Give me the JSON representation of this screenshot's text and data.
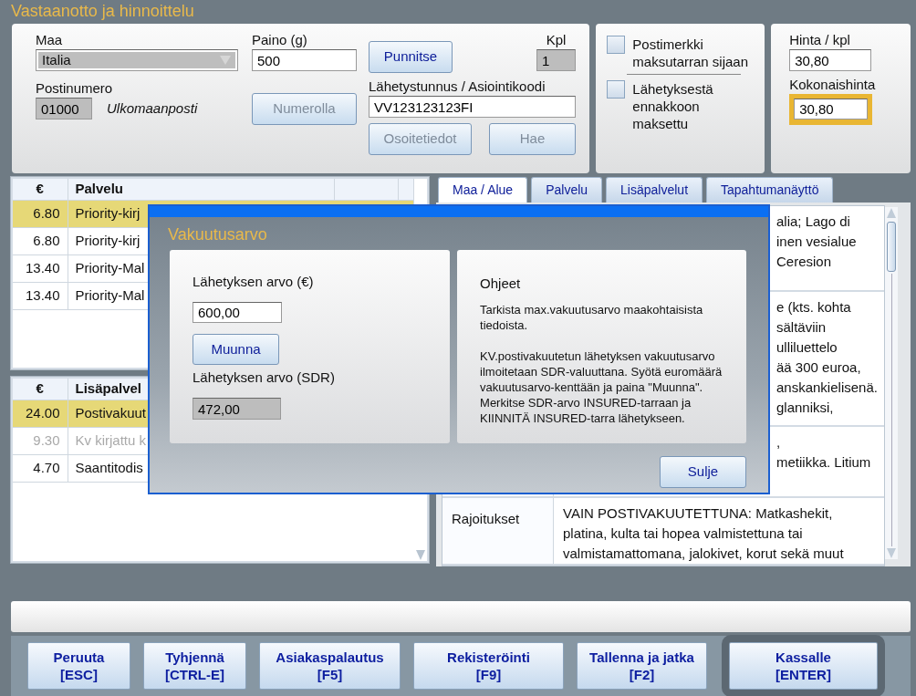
{
  "window": {
    "title": "Vastaanotto ja hinnoittelu"
  },
  "shipment": {
    "country_label": "Maa",
    "country": "Italia",
    "weight_label": "Paino (g)",
    "weight": "500",
    "weigh_button": "Punnitse",
    "qty_label": "Kpl",
    "qty": "1",
    "postcode_label": "Postinumero",
    "postcode": "01000",
    "postcode_area": "Ulkomaanposti",
    "by_number_button": {
      "label": "Numerolla",
      "disabled": true
    },
    "tracking_label": "Lähetystunnus / Asiointikoodi",
    "tracking": "VV123123123FI",
    "address_button": {
      "label": "Osoitetiedot",
      "disabled": true
    },
    "fetch_button": {
      "label": "Hae",
      "disabled": true
    }
  },
  "options": [
    {
      "label": "Postimerkki maksutarran sijaan",
      "checked": false
    },
    {
      "label": "Lähetyksestä ennakkoon maksettu",
      "checked": false
    }
  ],
  "prices": {
    "unit_label": "Hinta / kpl",
    "unit": "30,80",
    "total_label": "Kokonaishinta",
    "total": "30,80"
  },
  "services": {
    "columns": [
      "€",
      "Palvelu"
    ],
    "rows": [
      {
        "price": "6.80",
        "name": "Priority-kirj",
        "selected": true,
        "disabled": false
      },
      {
        "price": "6.80",
        "name": "Priority-kirj",
        "selected": false,
        "disabled": false
      },
      {
        "price": "13.40",
        "name": "Priority-Mal",
        "selected": false,
        "disabled": false
      },
      {
        "price": "13.40",
        "name": "Priority-Mal",
        "selected": false,
        "disabled": false
      }
    ]
  },
  "extras": {
    "columns": [
      "€",
      "Lisäpalvel"
    ],
    "rows": [
      {
        "price": "24.00",
        "name": "Postivakuut",
        "selected": true,
        "disabled": false
      },
      {
        "price": "9.30",
        "name": "Kv kirjattu k",
        "selected": false,
        "disabled": true
      },
      {
        "price": "4.70",
        "name": "Saantitodis",
        "selected": false,
        "disabled": false
      }
    ]
  },
  "tabs": [
    {
      "label": "Maa / Alue",
      "selected": true
    },
    {
      "label": "Palvelu",
      "selected": false
    },
    {
      "label": "Lisäpalvelut",
      "selected": false
    },
    {
      "label": "Tapahtumanäyttö",
      "selected": false
    }
  ],
  "info": {
    "rows": [
      {
        "kind": "covered",
        "lines": [
          "alia; Lago di",
          "inen vesialue",
          "Ceresion"
        ]
      },
      {
        "kind": "covered",
        "lines": [
          "e (kts. kohta",
          "sältäviin",
          "ulliluettelo",
          "ää 300 euroa,",
          "anskankielisenä.",
          "glanniksi,"
        ]
      },
      {
        "kind": "covered",
        "lines": [
          ",",
          "metiikka. Litium"
        ]
      },
      {
        "kind": "full",
        "label": "Rajoitukset",
        "lines": [
          "VAIN POSTIVAKUUTETTUNA: Matkashekit,",
          "platina, kulta tai hopea valmistettuna tai",
          "valmistamattomana, jalokivet, korut sekä muut"
        ]
      }
    ]
  },
  "dialog": {
    "title": "Vakuutusarvo",
    "value_label": "Lähetyksen arvo (€)",
    "value": "600,00",
    "convert_button": "Muunna",
    "sdr_label": "Lähetyksen arvo (SDR)",
    "sdr": "472,00",
    "help_title": "Ohjeet",
    "help_paragraphs": [
      "Tarkista max.vakuutusarvo maakohtaisista tiedoista.",
      "KV.postivakuutetun lähetyksen vakuutusarvo ilmoitetaan SDR-valuuttana. Syötä euromäärä vakuutusarvo-kenttään ja paina \"Muunna\".",
      "Merkitse SDR-arvo INSURED-tarraan ja KIINNITÄ INSURED-tarra lähetykseen."
    ],
    "close_button": "Sulje"
  },
  "actions": [
    {
      "label": "Peruuta",
      "key": "[ESC]",
      "kind": "normal"
    },
    {
      "label": "Tyhjennä",
      "key": "[CTRL-E]",
      "kind": "normal"
    },
    {
      "label": "Asiakaspalautus",
      "key": "[F5]",
      "kind": "normal"
    },
    {
      "label": "Rekisteröinti",
      "key": "[F9]",
      "kind": "normal"
    },
    {
      "label": "Tallenna ja jatka",
      "key": "[F2]",
      "kind": "normal"
    },
    {
      "label": "Kassalle",
      "key": "[ENTER]",
      "kind": "primary"
    }
  ]
}
